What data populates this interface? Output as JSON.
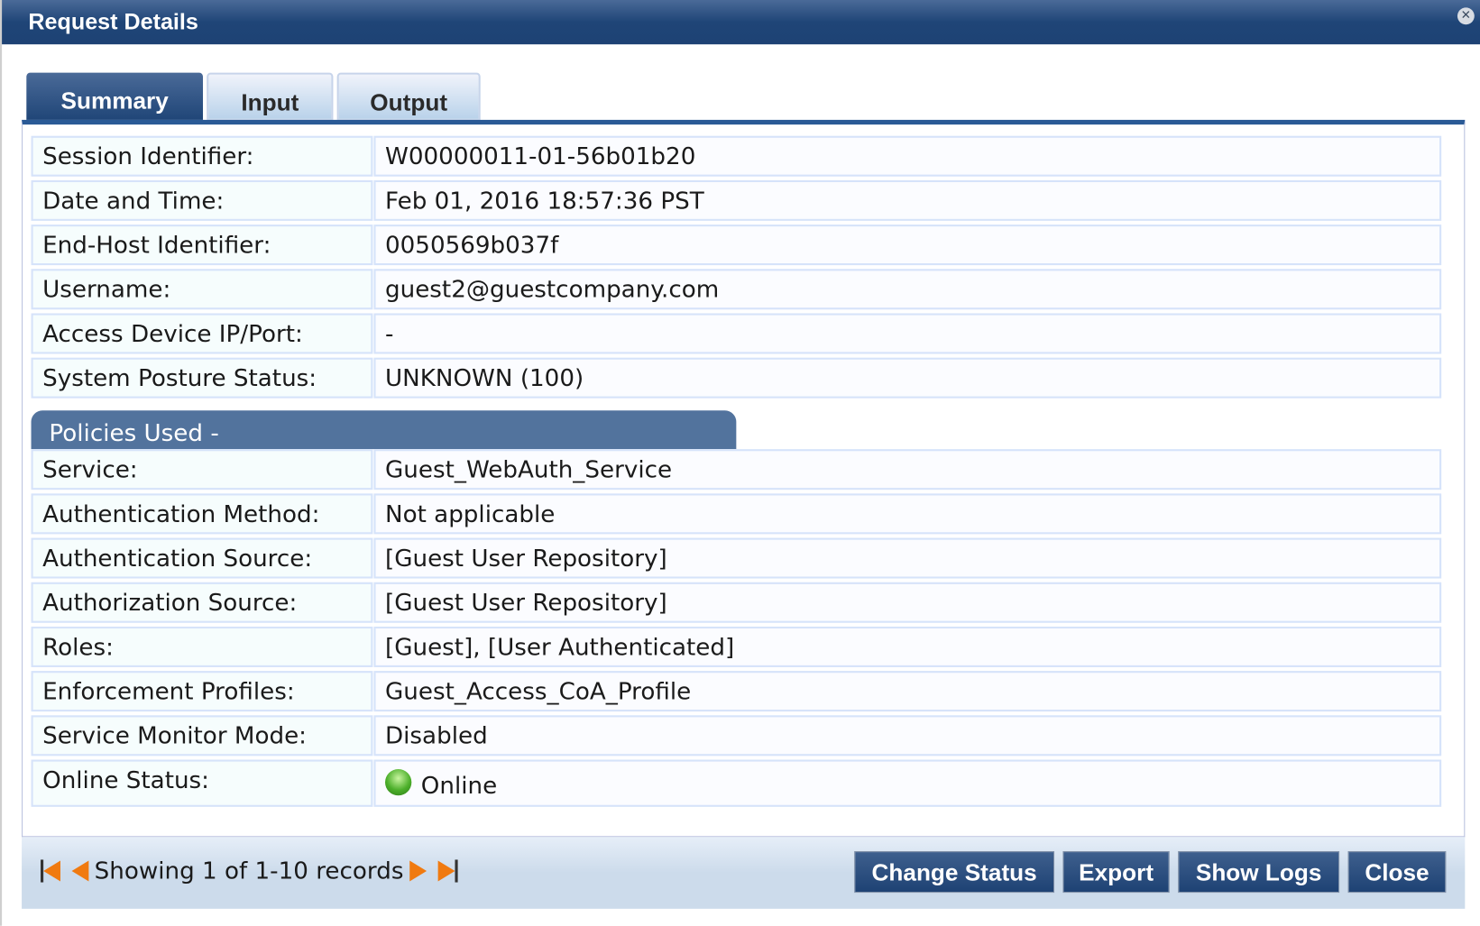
{
  "window": {
    "title": "Request Details",
    "close_icon": "close-icon"
  },
  "tabs": [
    {
      "label": "Summary",
      "active": true
    },
    {
      "label": "Input"
    },
    {
      "label": "Output"
    }
  ],
  "summary": [
    {
      "label": "Session Identifier:",
      "value": "W00000011-01-56b01b20"
    },
    {
      "label": "Date and Time:",
      "value": "Feb 01, 2016 18:57:36 PST"
    },
    {
      "label": "End-Host Identifier:",
      "value": "0050569b037f"
    },
    {
      "label": "Username:",
      "value": "guest2@guestcompany.com"
    },
    {
      "label": "Access Device IP/Port:",
      "value": "-"
    },
    {
      "label": "System Posture Status:",
      "value": "UNKNOWN (100)"
    }
  ],
  "policies_header": "Policies Used -",
  "policies": [
    {
      "label": "Service:",
      "value": "Guest_WebAuth_Service"
    },
    {
      "label": "Authentication Method:",
      "value": "Not applicable"
    },
    {
      "label": "Authentication Source:",
      "value": "[Guest User Repository]"
    },
    {
      "label": "Authorization Source:",
      "value": "[Guest User Repository]"
    },
    {
      "label": "Roles:",
      "value": "[Guest], [User Authenticated]"
    },
    {
      "label": "Enforcement Profiles:",
      "value": "Guest_Access_CoA_Profile"
    },
    {
      "label": "Service Monitor Mode:",
      "value": "Disabled"
    },
    {
      "label": "Online Status:",
      "value": "Online",
      "status_color": "#4caf2a"
    }
  ],
  "footer": {
    "records_text": "Showing 1 of 1-10 records",
    "buttons": [
      "Change Status",
      "Export",
      "Show Logs",
      "Close"
    ]
  }
}
